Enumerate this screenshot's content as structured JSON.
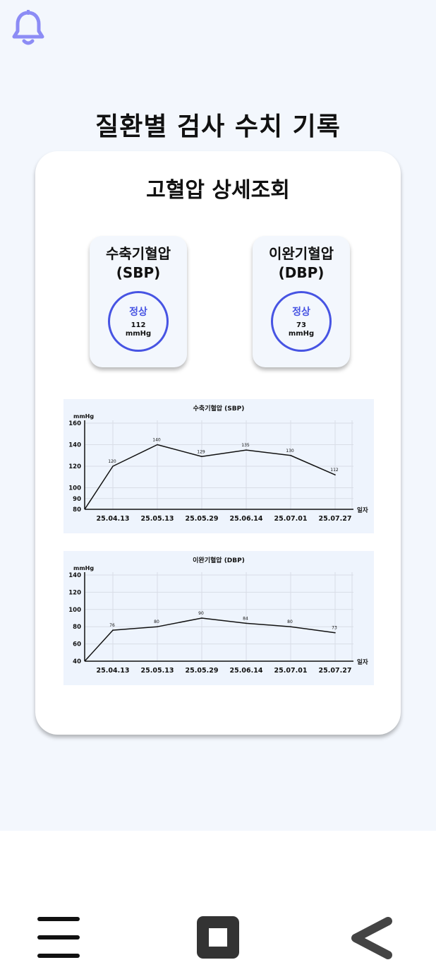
{
  "header": {
    "title": "질환별 검사 수치 기록",
    "bell_icon": "bell-icon"
  },
  "card": {
    "title": "고혈압 상세조회"
  },
  "metrics": [
    {
      "title_line1": "수축기혈압",
      "title_line2": "(SBP)",
      "status": "정상",
      "value": "112",
      "unit": "mmHg"
    },
    {
      "title_line1": "이완기혈압",
      "title_line2": "(DBP)",
      "status": "정상",
      "value": "73",
      "unit": "mmHg"
    }
  ],
  "colors": {
    "accent": "#4754e3",
    "bell": "#8c8cf5",
    "background": "#f3f7fd",
    "chart_bg": "#eef4fd"
  },
  "chart_data": [
    {
      "type": "line",
      "title": "수축기혈압 (SBP)",
      "ylabel": "mmHg",
      "xlabel": "일자",
      "x": [
        "25.04.13",
        "25.05.13",
        "25.05.29",
        "25.06.14",
        "25.07.01",
        "25.07.27"
      ],
      "y": [
        120,
        140,
        129,
        135,
        130,
        112
      ],
      "ylim": [
        80,
        160
      ],
      "yticks": [
        80,
        90,
        100,
        120,
        140,
        160
      ],
      "grid": true
    },
    {
      "type": "line",
      "title": "이완기혈압 (DBP)",
      "ylabel": "mmHg",
      "xlabel": "일자",
      "x": [
        "25.04.13",
        "25.05.13",
        "25.05.29",
        "25.06.14",
        "25.07.01",
        "25.07.27"
      ],
      "y": [
        76,
        80,
        90,
        84,
        80,
        73
      ],
      "ylim": [
        40,
        140
      ],
      "yticks": [
        40,
        60,
        80,
        100,
        120,
        140
      ],
      "grid": true
    }
  ],
  "nav": {
    "menu_icon": "menu-icon",
    "home_icon": "home-square-icon",
    "back_icon": "back-chevron-icon"
  }
}
